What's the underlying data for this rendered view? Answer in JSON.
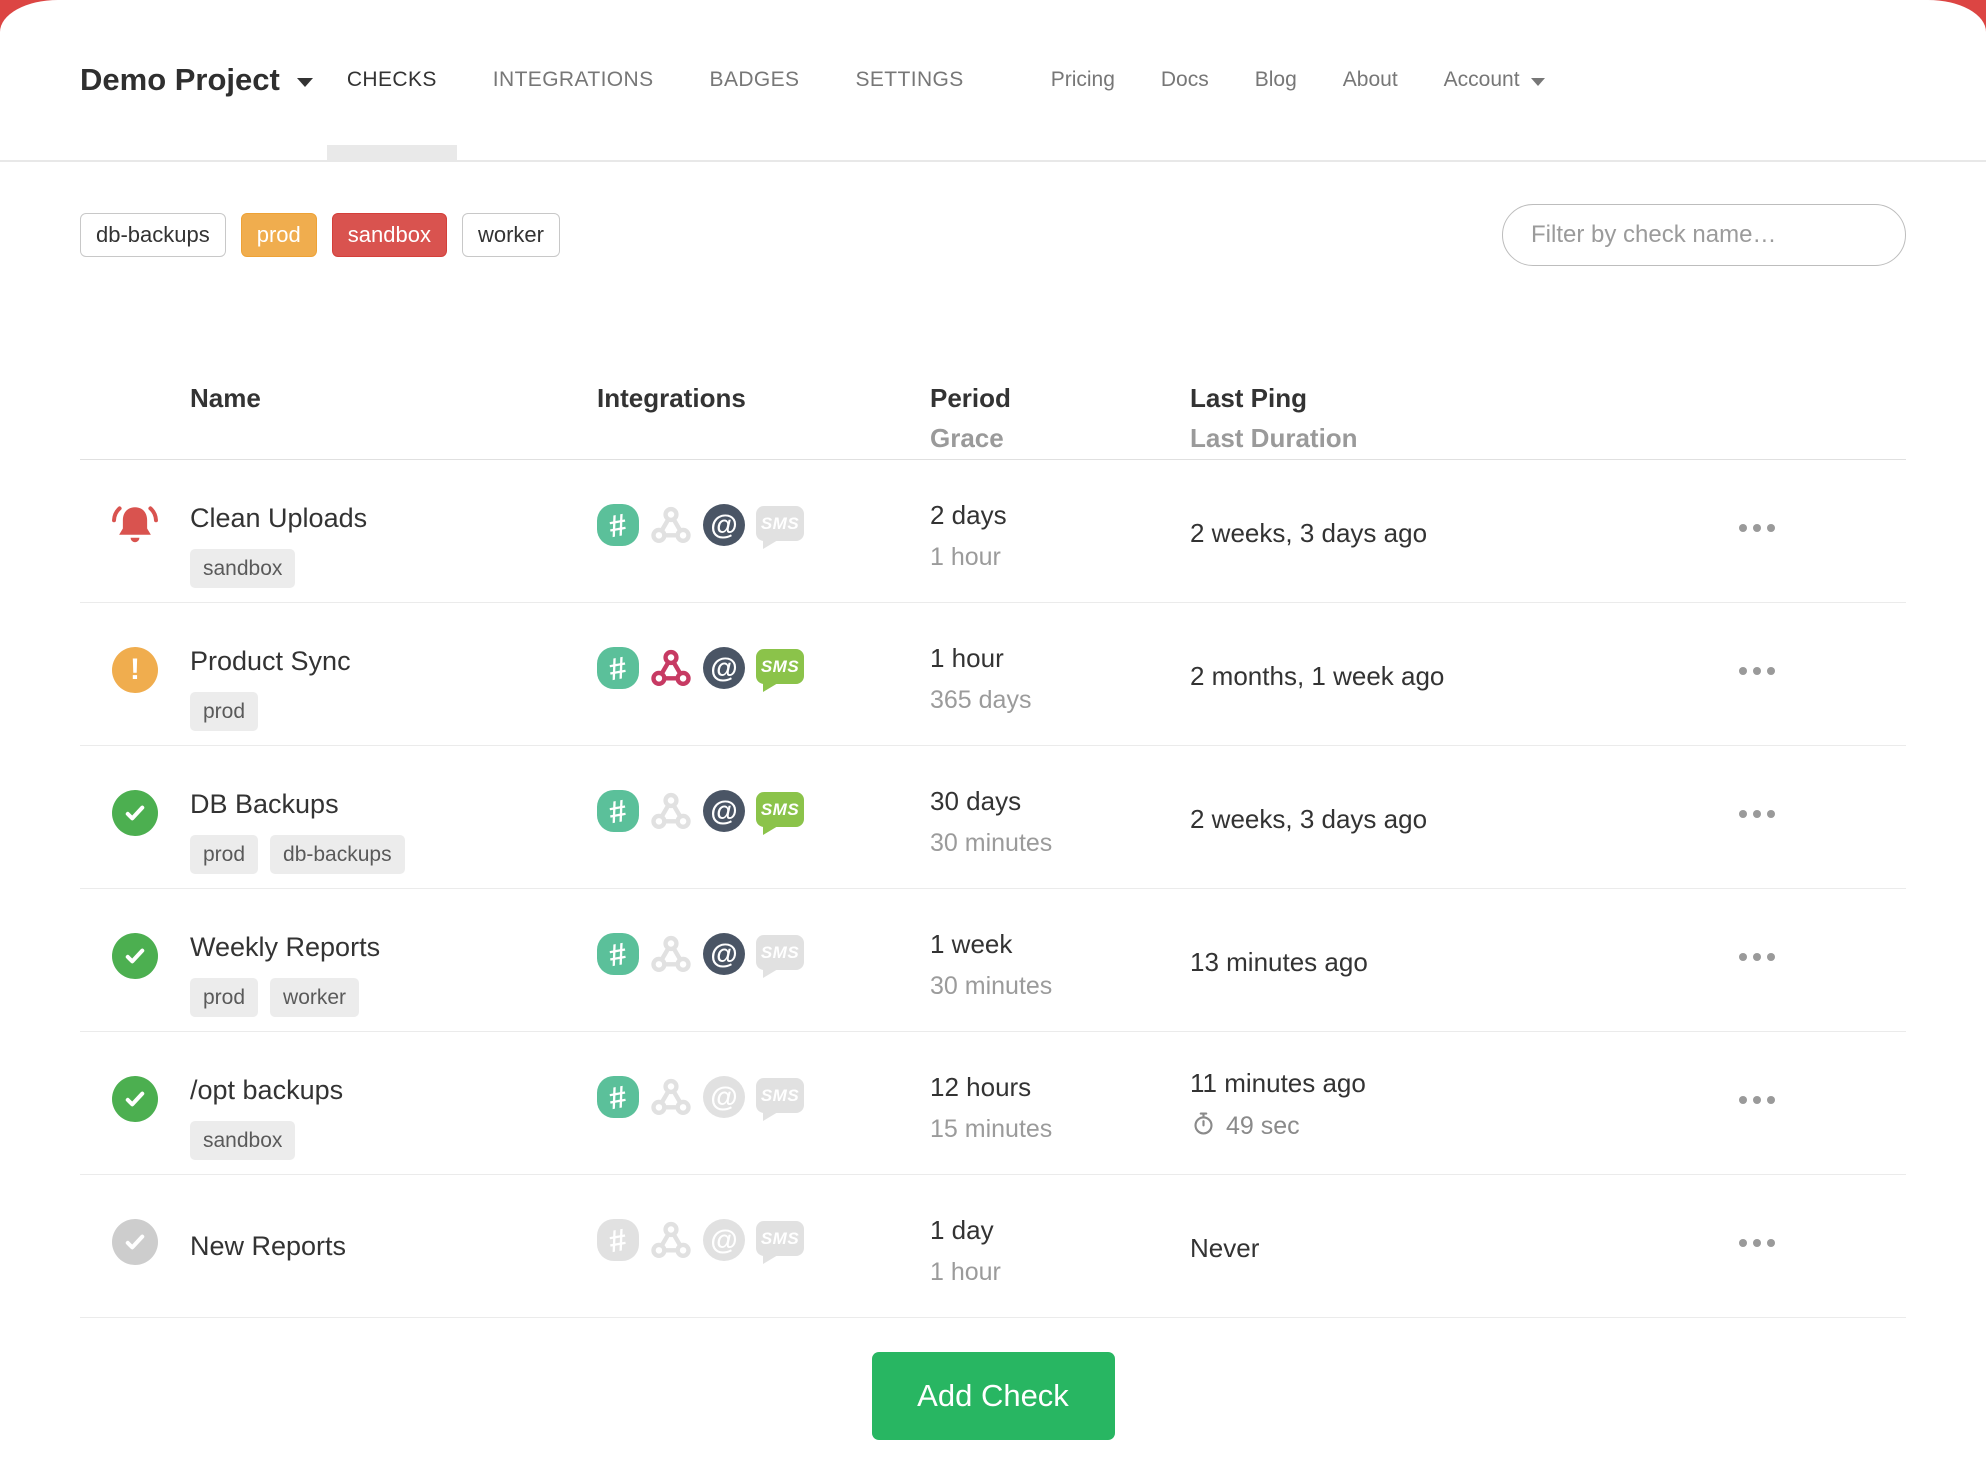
{
  "nav": {
    "project_name": "Demo Project",
    "tabs": [
      {
        "label": "CHECKS",
        "active": true
      },
      {
        "label": "INTEGRATIONS",
        "active": false
      },
      {
        "label": "BADGES",
        "active": false
      },
      {
        "label": "SETTINGS",
        "active": false
      }
    ],
    "links": [
      {
        "label": "Pricing"
      },
      {
        "label": "Docs"
      },
      {
        "label": "Blog"
      },
      {
        "label": "About"
      }
    ],
    "account_label": "Account"
  },
  "filters": {
    "tags": [
      {
        "label": "db-backups",
        "variant": "outline"
      },
      {
        "label": "prod",
        "variant": "warning"
      },
      {
        "label": "sandbox",
        "variant": "danger"
      },
      {
        "label": "worker",
        "variant": "outline"
      }
    ],
    "search_placeholder": "Filter by check name…"
  },
  "table": {
    "headers": {
      "name": "Name",
      "integrations": "Integrations",
      "period": "Period",
      "grace": "Grace",
      "last_ping": "Last Ping",
      "last_duration": "Last Duration"
    },
    "rows": [
      {
        "status": "alert",
        "name": "Clean Uploads",
        "tags": [
          "sandbox"
        ],
        "integrations": [
          {
            "name": "slack",
            "active": true
          },
          {
            "name": "webhook",
            "active": false
          },
          {
            "name": "email",
            "active": true
          },
          {
            "name": "sms",
            "active": false
          }
        ],
        "period": "2 days",
        "grace": "1 hour",
        "last_ping": "2 weeks, 3 days ago",
        "last_duration": null
      },
      {
        "status": "late",
        "name": "Product Sync",
        "tags": [
          "prod"
        ],
        "integrations": [
          {
            "name": "slack",
            "active": true
          },
          {
            "name": "webhook",
            "active": true
          },
          {
            "name": "email",
            "active": true
          },
          {
            "name": "sms",
            "active": true
          }
        ],
        "period": "1 hour",
        "grace": "365 days",
        "last_ping": "2 months, 1 week ago",
        "last_duration": null
      },
      {
        "status": "up",
        "name": "DB Backups",
        "tags": [
          "prod",
          "db-backups"
        ],
        "integrations": [
          {
            "name": "slack",
            "active": true
          },
          {
            "name": "webhook",
            "active": false
          },
          {
            "name": "email",
            "active": true
          },
          {
            "name": "sms",
            "active": true
          }
        ],
        "period": "30 days",
        "grace": "30 minutes",
        "last_ping": "2 weeks, 3 days ago",
        "last_duration": null
      },
      {
        "status": "up",
        "name": "Weekly Reports",
        "tags": [
          "prod",
          "worker"
        ],
        "integrations": [
          {
            "name": "slack",
            "active": true
          },
          {
            "name": "webhook",
            "active": false
          },
          {
            "name": "email",
            "active": true
          },
          {
            "name": "sms",
            "active": false
          }
        ],
        "period": "1 week",
        "grace": "30 minutes",
        "last_ping": "13 minutes ago",
        "last_duration": null
      },
      {
        "status": "up",
        "name": "/opt backups",
        "tags": [
          "sandbox"
        ],
        "integrations": [
          {
            "name": "slack",
            "active": true
          },
          {
            "name": "webhook",
            "active": false
          },
          {
            "name": "email",
            "active": false
          },
          {
            "name": "sms",
            "active": false
          }
        ],
        "period": "12 hours",
        "grace": "15 minutes",
        "last_ping": "11 minutes ago",
        "last_duration": "49 sec"
      },
      {
        "status": "new",
        "name": "New Reports",
        "tags": [],
        "integrations": [
          {
            "name": "slack",
            "active": false
          },
          {
            "name": "webhook",
            "active": false
          },
          {
            "name": "email",
            "active": false
          },
          {
            "name": "sms",
            "active": false
          }
        ],
        "period": "1 day",
        "grace": "1 hour",
        "last_ping": "Never",
        "last_duration": null
      }
    ]
  },
  "add_check_label": "Add Check",
  "colors": {
    "status_up": "#4caf50",
    "status_late": "#f0ad4e",
    "status_alert": "#d9534f",
    "status_new": "#cdcdcd",
    "tag_warning": "#f0ad4e",
    "tag_danger": "#d9534f",
    "slack": "#5bc09a",
    "webhook": "#c73a63",
    "email": "#4a5565",
    "sms": "#8bc34a",
    "icon_inactive": "#e1e1e1",
    "add_button": "#28b662"
  }
}
